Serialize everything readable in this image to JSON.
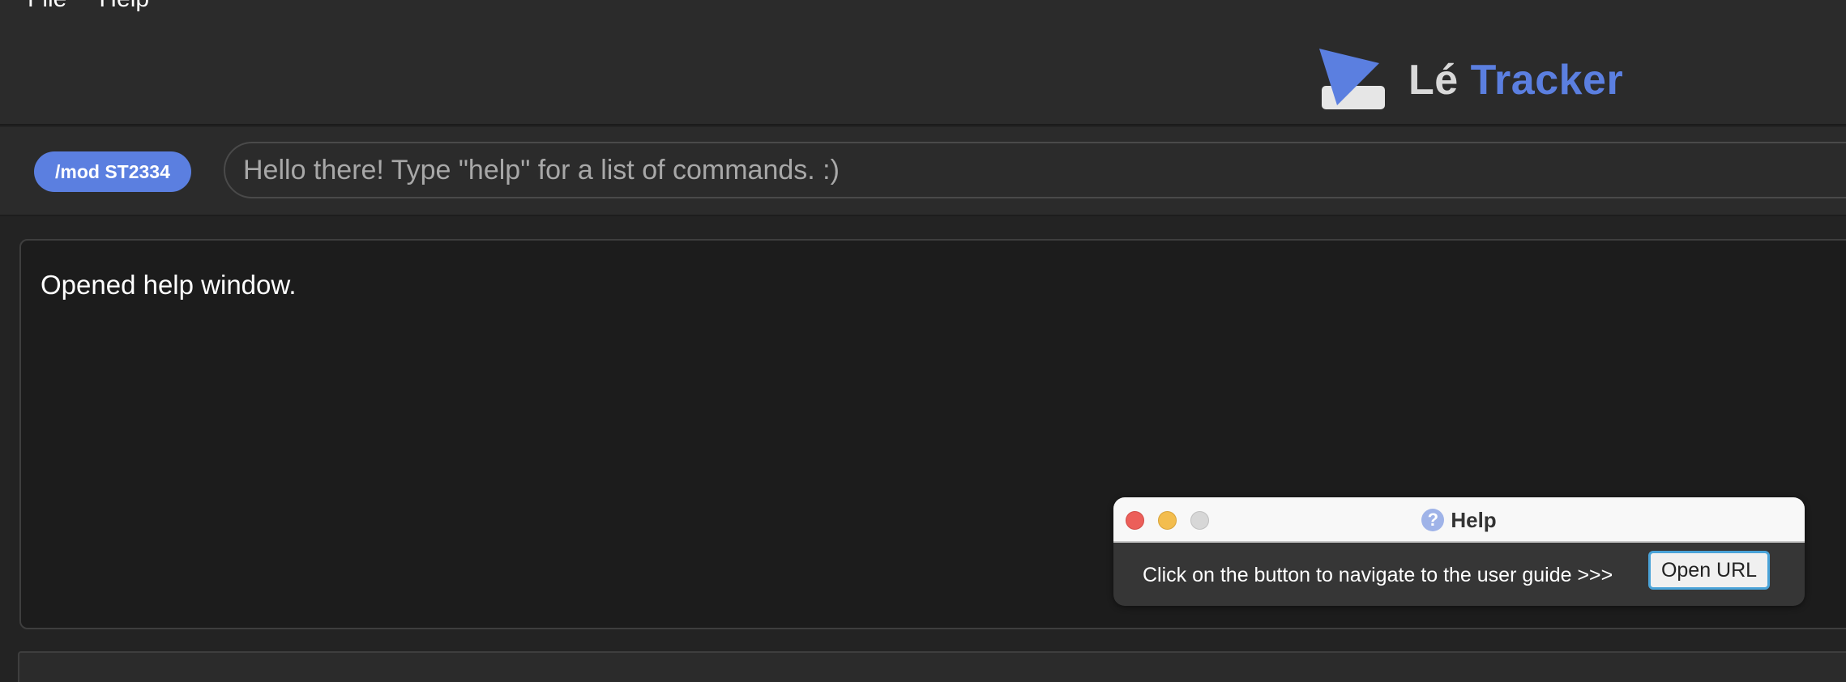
{
  "menu": {
    "items": [
      {
        "label": "File"
      },
      {
        "label": "Help"
      }
    ]
  },
  "header": {
    "logo_text_first": "Lé",
    "logo_text_second": "Tracker",
    "logo_icon": "play-triangle-icon",
    "colors": {
      "accent": "#5b7fe0",
      "logo_first": "#d9d9d9"
    }
  },
  "command": {
    "module_badge": "/mod ST2334",
    "placeholder": "Hello there! Type \"help\" for a list of commands. :)",
    "value": ""
  },
  "result": {
    "message": "Opened help window."
  },
  "help_window": {
    "title": "Help",
    "title_icon": "question-mark-icon",
    "message": "Click on the button to navigate to the user guide >>>",
    "button_label": "Open URL",
    "traffic_lights": [
      "close",
      "minimize",
      "zoom"
    ]
  }
}
